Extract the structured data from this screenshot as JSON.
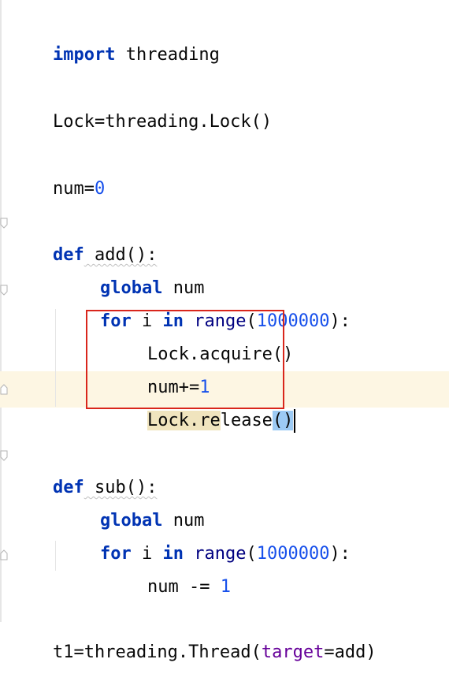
{
  "editor": {
    "lines": [
      {
        "kw": "import",
        "rest": " threading"
      },
      {
        "text": "Lock=threading.Lock()"
      },
      {
        "pre": "num=",
        "num": "0"
      },
      {
        "kw": "def",
        "rest": " add():"
      },
      {
        "kw": "global",
        "rest": " num"
      },
      {
        "kw": "for",
        "mid": " i ",
        "kw2": "in",
        "sp": " ",
        "builtin": "range",
        "open": "(",
        "num": "1000000",
        "close": "):"
      },
      {
        "text": "Lock.acquire()"
      },
      {
        "pre": "num+=",
        "num": "1"
      },
      {
        "usage": "Lock.re",
        "rest": "lease",
        "parens": "()"
      },
      {
        "kw": "def",
        "rest": " sub():"
      },
      {
        "kw": "global",
        "rest": " num"
      },
      {
        "kw": "for",
        "mid": " i ",
        "kw2": "in",
        "sp": " ",
        "builtin": "range",
        "open": "(",
        "num": "1000000",
        "close": "):"
      },
      {
        "pre": "num -= ",
        "num": "1"
      },
      {
        "pre": "t1=threading.Thread(",
        "param": "target",
        "post": "=add)"
      }
    ]
  }
}
